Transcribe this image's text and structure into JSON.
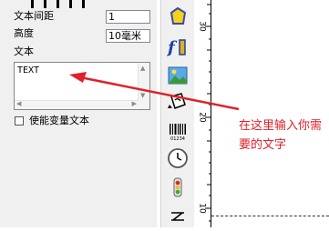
{
  "left_panel": {
    "text_spacing_label": "文本间距",
    "text_spacing_value": "1",
    "height_label": "高度",
    "height_value": "10毫米",
    "text_label": "文本",
    "text_content": "TEXT",
    "enable_variable_label": "使能变量文本"
  },
  "toolbar": {
    "items": [
      {
        "icon": "polygon-shape-icon"
      },
      {
        "icon": "text-tool-icon"
      },
      {
        "icon": "image-tool-icon"
      },
      {
        "icon": "rotate-object-icon"
      },
      {
        "icon": "barcode-icon",
        "caption": "01234"
      },
      {
        "icon": "clock-icon"
      },
      {
        "icon": "traffic-light-icon"
      },
      {
        "icon": "symbol-tool-icon"
      }
    ]
  },
  "ruler": {
    "labels": [
      "30",
      "20",
      "10"
    ]
  },
  "annotation": {
    "text": "在这里输入你需要的文字",
    "color": "#e0202a"
  }
}
